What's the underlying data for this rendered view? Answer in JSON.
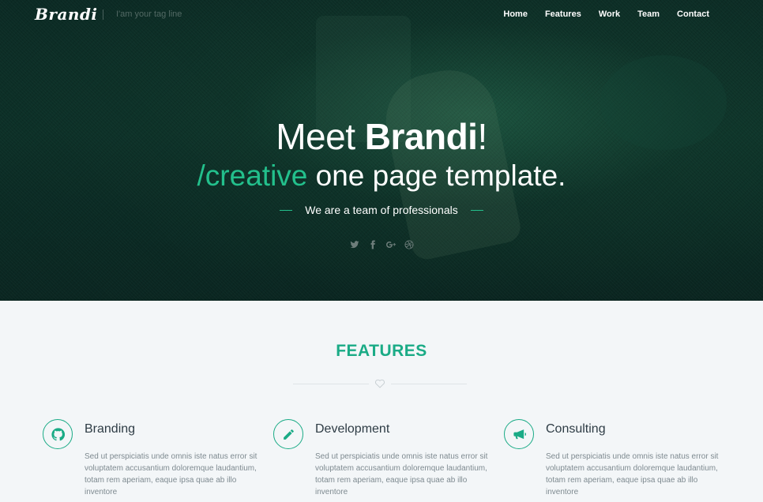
{
  "nav": {
    "logo": "Brandi",
    "tagline": "I'am your tag line",
    "items": [
      {
        "label": "Home"
      },
      {
        "label": "Features"
      },
      {
        "label": "Work"
      },
      {
        "label": "Team"
      },
      {
        "label": "Contact"
      }
    ]
  },
  "hero": {
    "headline_prefix": "Meet ",
    "headline_bold": "Brandi",
    "headline_suffix": "!",
    "subline_accent": "/creative",
    "subline_rest": " one page template.",
    "tagline": "We are a team of professionals",
    "social": [
      "twitter-icon",
      "facebook-icon",
      "google-plus-icon",
      "dribbble-icon"
    ]
  },
  "features": {
    "title": "FEATURES",
    "items": [
      {
        "icon": "github-icon",
        "title": "Branding",
        "text": "Sed ut perspiciatis unde omnis iste natus error sit voluptatem accusantium doloremque laudantium, totam rem aperiam, eaque ipsa quae ab illo inventore"
      },
      {
        "icon": "pencil-icon",
        "title": "Development",
        "text": "Sed ut perspiciatis unde omnis iste natus error sit voluptatem accusantium doloremque laudantium, totam rem aperiam, eaque ipsa quae ab illo inventore"
      },
      {
        "icon": "megaphone-icon",
        "title": "Consulting",
        "text": "Sed ut perspiciatis unde omnis iste natus error sit voluptatem accusantium doloremque laudantium, totam rem aperiam, eaque ipsa quae ab illo inventore"
      }
    ]
  },
  "colors": {
    "accent": "#1aab86",
    "hero_accent": "#23c08c",
    "hero_bg": "#0d3329",
    "section_bg": "#f3f6f8"
  }
}
